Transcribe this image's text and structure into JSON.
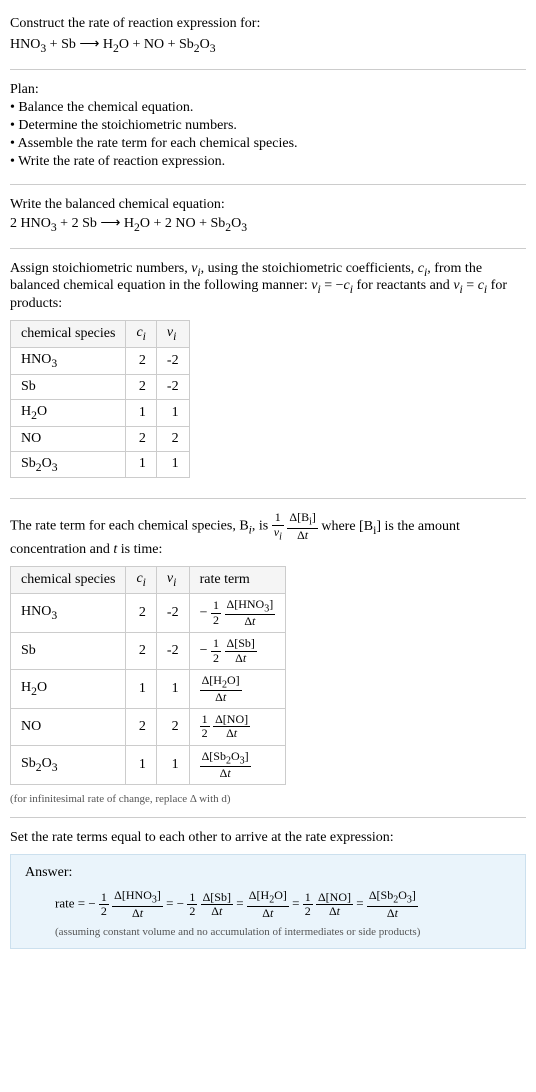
{
  "header": {
    "title": "Construct the rate of reaction expression for:",
    "equation_html": "HNO<sub>3</sub> + Sb ⟶ H<sub>2</sub>O + NO + Sb<sub>2</sub>O<sub>3</sub>"
  },
  "plan": {
    "title": "Plan:",
    "items": [
      "Balance the chemical equation.",
      "Determine the stoichiometric numbers.",
      "Assemble the rate term for each chemical species.",
      "Write the rate of reaction expression."
    ]
  },
  "balanced": {
    "title": "Write the balanced chemical equation:",
    "equation_html": "2 HNO<sub>3</sub> + 2 Sb ⟶ H<sub>2</sub>O + 2 NO + Sb<sub>2</sub>O<sub>3</sub>"
  },
  "stoich": {
    "intro_html": "Assign stoichiometric numbers, <i>ν<sub>i</sub></i>, using the stoichiometric coefficients, <i>c<sub>i</sub></i>, from the balanced chemical equation in the following manner: <i>ν<sub>i</sub></i> = −<i>c<sub>i</sub></i> for reactants and <i>ν<sub>i</sub></i> = <i>c<sub>i</sub></i> for products:",
    "headers": {
      "species": "chemical species",
      "ci": "c_i",
      "vi": "ν_i"
    },
    "rows": [
      {
        "species_html": "HNO<sub>3</sub>",
        "ci": "2",
        "vi": "-2"
      },
      {
        "species_html": "Sb",
        "ci": "2",
        "vi": "-2"
      },
      {
        "species_html": "H<sub>2</sub>O",
        "ci": "1",
        "vi": "1"
      },
      {
        "species_html": "NO",
        "ci": "2",
        "vi": "2"
      },
      {
        "species_html": "Sb<sub>2</sub>O<sub>3</sub>",
        "ci": "1",
        "vi": "1"
      }
    ]
  },
  "rateterm": {
    "intro_pre": "The rate term for each chemical species, B",
    "intro_mid": ", is ",
    "intro_post_html": " where [B<sub>i</sub>] is the amount concentration and <i>t</i> is time:",
    "headers": {
      "species": "chemical species",
      "ci": "c_i",
      "vi": "ν_i",
      "rate": "rate term"
    },
    "rows": [
      {
        "species_html": "HNO<sub>3</sub>",
        "ci": "2",
        "vi": "-2",
        "sign": "−",
        "coef_num": "1",
        "coef_den": "2",
        "delta_num_html": "Δ[HNO<sub>3</sub>]",
        "delta_den_html": "Δ<i>t</i>"
      },
      {
        "species_html": "Sb",
        "ci": "2",
        "vi": "-2",
        "sign": "−",
        "coef_num": "1",
        "coef_den": "2",
        "delta_num_html": "Δ[Sb]",
        "delta_den_html": "Δ<i>t</i>"
      },
      {
        "species_html": "H<sub>2</sub>O",
        "ci": "1",
        "vi": "1",
        "sign": "",
        "coef_num": "",
        "coef_den": "",
        "delta_num_html": "Δ[H<sub>2</sub>O]",
        "delta_den_html": "Δ<i>t</i>"
      },
      {
        "species_html": "NO",
        "ci": "2",
        "vi": "2",
        "sign": "",
        "coef_num": "1",
        "coef_den": "2",
        "delta_num_html": "Δ[NO]",
        "delta_den_html": "Δ<i>t</i>"
      },
      {
        "species_html": "Sb<sub>2</sub>O<sub>3</sub>",
        "ci": "1",
        "vi": "1",
        "sign": "",
        "coef_num": "",
        "coef_den": "",
        "delta_num_html": "Δ[Sb<sub>2</sub>O<sub>3</sub>]",
        "delta_den_html": "Δ<i>t</i>"
      }
    ],
    "note": "(for infinitesimal rate of change, replace Δ with d)"
  },
  "final": {
    "title": "Set the rate terms equal to each other to arrive at the rate expression:"
  },
  "answer": {
    "label": "Answer:",
    "prefix": "rate = ",
    "terms": [
      {
        "sign": "−",
        "coef_num": "1",
        "coef_den": "2",
        "delta_num_html": "Δ[HNO<sub>3</sub>]",
        "delta_den_html": "Δ<i>t</i>"
      },
      {
        "sign": "−",
        "coef_num": "1",
        "coef_den": "2",
        "delta_num_html": "Δ[Sb]",
        "delta_den_html": "Δ<i>t</i>"
      },
      {
        "sign": "",
        "coef_num": "",
        "coef_den": "",
        "delta_num_html": "Δ[H<sub>2</sub>O]",
        "delta_den_html": "Δ<i>t</i>"
      },
      {
        "sign": "",
        "coef_num": "1",
        "coef_den": "2",
        "delta_num_html": "Δ[NO]",
        "delta_den_html": "Δ<i>t</i>"
      },
      {
        "sign": "",
        "coef_num": "",
        "coef_den": "",
        "delta_num_html": "Δ[Sb<sub>2</sub>O<sub>3</sub>]",
        "delta_den_html": "Δ<i>t</i>"
      }
    ],
    "note": "(assuming constant volume and no accumulation of intermediates or side products)"
  }
}
